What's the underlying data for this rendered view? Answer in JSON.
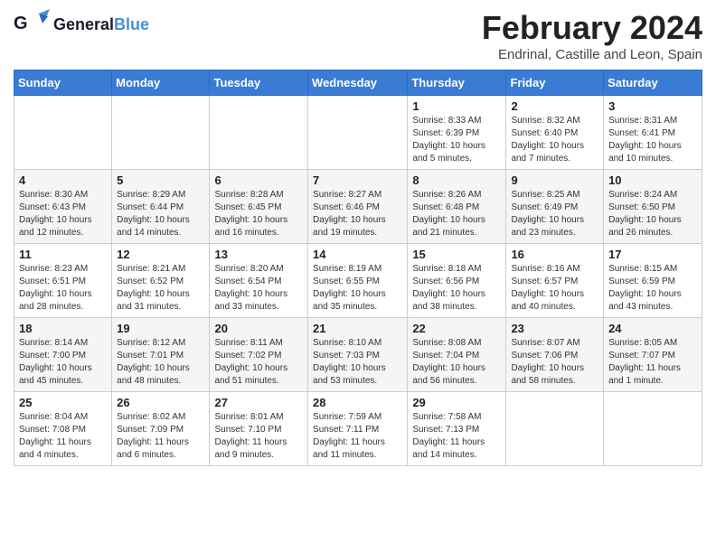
{
  "header": {
    "logo_general": "General",
    "logo_blue": "Blue",
    "month": "February 2024",
    "location": "Endrinal, Castille and Leon, Spain"
  },
  "weekdays": [
    "Sunday",
    "Monday",
    "Tuesday",
    "Wednesday",
    "Thursday",
    "Friday",
    "Saturday"
  ],
  "weeks": [
    [
      {
        "day": "",
        "info": ""
      },
      {
        "day": "",
        "info": ""
      },
      {
        "day": "",
        "info": ""
      },
      {
        "day": "",
        "info": ""
      },
      {
        "day": "1",
        "info": "Sunrise: 8:33 AM\nSunset: 6:39 PM\nDaylight: 10 hours\nand 5 minutes."
      },
      {
        "day": "2",
        "info": "Sunrise: 8:32 AM\nSunset: 6:40 PM\nDaylight: 10 hours\nand 7 minutes."
      },
      {
        "day": "3",
        "info": "Sunrise: 8:31 AM\nSunset: 6:41 PM\nDaylight: 10 hours\nand 10 minutes."
      }
    ],
    [
      {
        "day": "4",
        "info": "Sunrise: 8:30 AM\nSunset: 6:43 PM\nDaylight: 10 hours\nand 12 minutes."
      },
      {
        "day": "5",
        "info": "Sunrise: 8:29 AM\nSunset: 6:44 PM\nDaylight: 10 hours\nand 14 minutes."
      },
      {
        "day": "6",
        "info": "Sunrise: 8:28 AM\nSunset: 6:45 PM\nDaylight: 10 hours\nand 16 minutes."
      },
      {
        "day": "7",
        "info": "Sunrise: 8:27 AM\nSunset: 6:46 PM\nDaylight: 10 hours\nand 19 minutes."
      },
      {
        "day": "8",
        "info": "Sunrise: 8:26 AM\nSunset: 6:48 PM\nDaylight: 10 hours\nand 21 minutes."
      },
      {
        "day": "9",
        "info": "Sunrise: 8:25 AM\nSunset: 6:49 PM\nDaylight: 10 hours\nand 23 minutes."
      },
      {
        "day": "10",
        "info": "Sunrise: 8:24 AM\nSunset: 6:50 PM\nDaylight: 10 hours\nand 26 minutes."
      }
    ],
    [
      {
        "day": "11",
        "info": "Sunrise: 8:23 AM\nSunset: 6:51 PM\nDaylight: 10 hours\nand 28 minutes."
      },
      {
        "day": "12",
        "info": "Sunrise: 8:21 AM\nSunset: 6:52 PM\nDaylight: 10 hours\nand 31 minutes."
      },
      {
        "day": "13",
        "info": "Sunrise: 8:20 AM\nSunset: 6:54 PM\nDaylight: 10 hours\nand 33 minutes."
      },
      {
        "day": "14",
        "info": "Sunrise: 8:19 AM\nSunset: 6:55 PM\nDaylight: 10 hours\nand 35 minutes."
      },
      {
        "day": "15",
        "info": "Sunrise: 8:18 AM\nSunset: 6:56 PM\nDaylight: 10 hours\nand 38 minutes."
      },
      {
        "day": "16",
        "info": "Sunrise: 8:16 AM\nSunset: 6:57 PM\nDaylight: 10 hours\nand 40 minutes."
      },
      {
        "day": "17",
        "info": "Sunrise: 8:15 AM\nSunset: 6:59 PM\nDaylight: 10 hours\nand 43 minutes."
      }
    ],
    [
      {
        "day": "18",
        "info": "Sunrise: 8:14 AM\nSunset: 7:00 PM\nDaylight: 10 hours\nand 45 minutes."
      },
      {
        "day": "19",
        "info": "Sunrise: 8:12 AM\nSunset: 7:01 PM\nDaylight: 10 hours\nand 48 minutes."
      },
      {
        "day": "20",
        "info": "Sunrise: 8:11 AM\nSunset: 7:02 PM\nDaylight: 10 hours\nand 51 minutes."
      },
      {
        "day": "21",
        "info": "Sunrise: 8:10 AM\nSunset: 7:03 PM\nDaylight: 10 hours\nand 53 minutes."
      },
      {
        "day": "22",
        "info": "Sunrise: 8:08 AM\nSunset: 7:04 PM\nDaylight: 10 hours\nand 56 minutes."
      },
      {
        "day": "23",
        "info": "Sunrise: 8:07 AM\nSunset: 7:06 PM\nDaylight: 10 hours\nand 58 minutes."
      },
      {
        "day": "24",
        "info": "Sunrise: 8:05 AM\nSunset: 7:07 PM\nDaylight: 11 hours\nand 1 minute."
      }
    ],
    [
      {
        "day": "25",
        "info": "Sunrise: 8:04 AM\nSunset: 7:08 PM\nDaylight: 11 hours\nand 4 minutes."
      },
      {
        "day": "26",
        "info": "Sunrise: 8:02 AM\nSunset: 7:09 PM\nDaylight: 11 hours\nand 6 minutes."
      },
      {
        "day": "27",
        "info": "Sunrise: 8:01 AM\nSunset: 7:10 PM\nDaylight: 11 hours\nand 9 minutes."
      },
      {
        "day": "28",
        "info": "Sunrise: 7:59 AM\nSunset: 7:11 PM\nDaylight: 11 hours\nand 11 minutes."
      },
      {
        "day": "29",
        "info": "Sunrise: 7:58 AM\nSunset: 7:13 PM\nDaylight: 11 hours\nand 14 minutes."
      },
      {
        "day": "",
        "info": ""
      },
      {
        "day": "",
        "info": ""
      }
    ]
  ]
}
